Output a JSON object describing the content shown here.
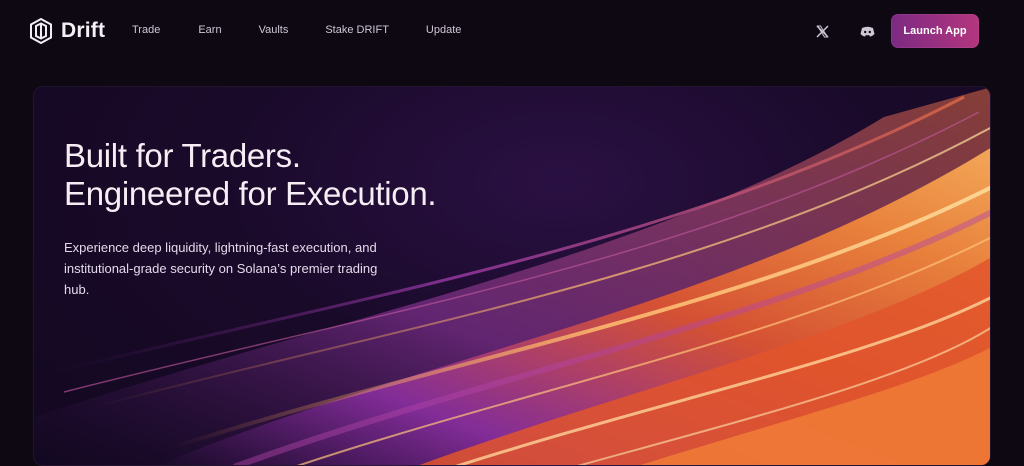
{
  "brand": {
    "name": "Drift",
    "logo_icon": "drift-logo-icon"
  },
  "nav": {
    "links": [
      "Trade",
      "Earn",
      "Vaults",
      "Stake DRIFT",
      "Update"
    ]
  },
  "social": {
    "x_icon": "x-twitter-icon",
    "discord_icon": "discord-icon"
  },
  "cta": {
    "launch_label": "Launch App"
  },
  "hero": {
    "title_line1": "Built for Traders.",
    "title_line2": "Engineered for Execution.",
    "subtitle": "Experience deep liquidity, lightning-fast execution, and institutional-grade security on Solana’s premier trading hub."
  },
  "colors": {
    "background": "#0e0812",
    "accent_start": "#7c2a83",
    "accent_end": "#b4357e",
    "streak_orange": "#f06a2a",
    "streak_purple": "#8a2fa0"
  }
}
